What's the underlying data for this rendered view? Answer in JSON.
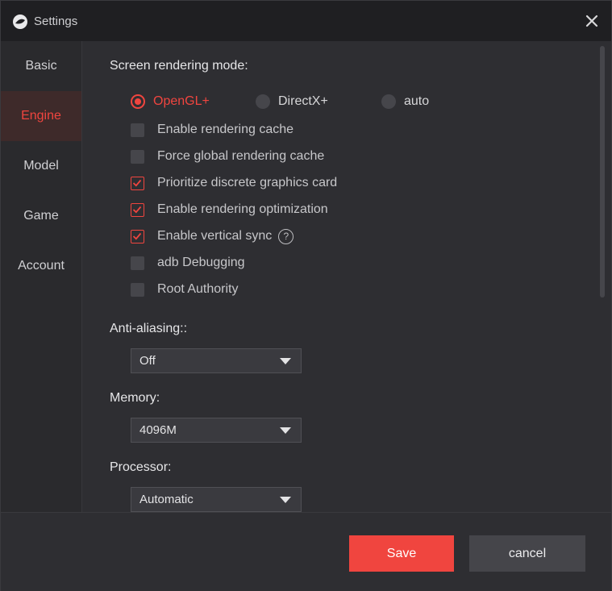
{
  "window": {
    "title": "Settings"
  },
  "sidebar": {
    "items": [
      {
        "label": "Basic",
        "active": false
      },
      {
        "label": "Engine",
        "active": true
      },
      {
        "label": "Model",
        "active": false
      },
      {
        "label": "Game",
        "active": false
      },
      {
        "label": "Account",
        "active": false
      }
    ]
  },
  "rendering": {
    "heading": "Screen rendering mode:",
    "modes": [
      {
        "label": "OpenGL+",
        "selected": true
      },
      {
        "label": "DirectX+",
        "selected": false
      },
      {
        "label": "auto",
        "selected": false
      }
    ]
  },
  "options": [
    {
      "label": "Enable rendering cache",
      "checked": false
    },
    {
      "label": "Force global rendering cache",
      "checked": false
    },
    {
      "label": "Prioritize discrete graphics card",
      "checked": true
    },
    {
      "label": "Enable rendering optimization",
      "checked": true
    },
    {
      "label": "Enable vertical sync",
      "checked": true,
      "help": "?"
    },
    {
      "label": "adb Debugging",
      "checked": false
    },
    {
      "label": "Root Authority",
      "checked": false
    }
  ],
  "anti_aliasing": {
    "label": "Anti-aliasing::",
    "value": "Off"
  },
  "memory": {
    "label": "Memory:",
    "value": "4096M"
  },
  "processor": {
    "label": "Processor:",
    "value": "Automatic"
  },
  "footer": {
    "save_label": "Save",
    "cancel_label": "cancel"
  },
  "colors": {
    "accent": "#f0453f",
    "background": "#2e2e32",
    "titlebar": "#1f1f22"
  },
  "icons": {
    "logo": "app-logo-icon",
    "close": "close-icon",
    "help": "help-icon",
    "dropdown": "chevron-down-icon"
  }
}
